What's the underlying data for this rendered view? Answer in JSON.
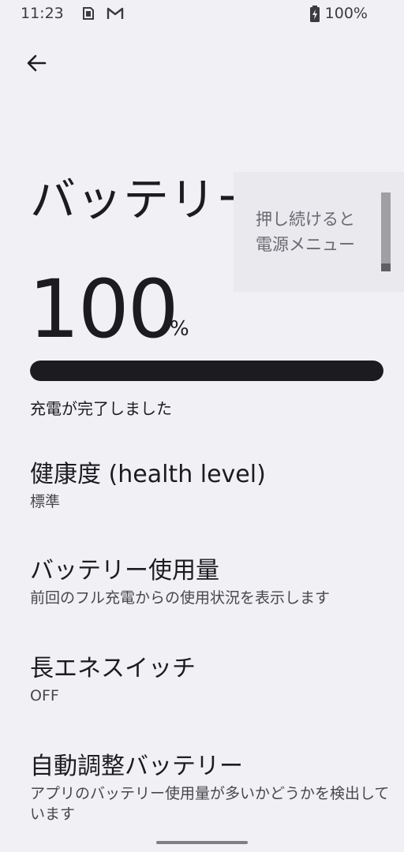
{
  "status_bar": {
    "time": "11:23",
    "battery_text": "100%",
    "icons": [
      "sim-card-icon",
      "gmail-icon",
      "battery-charging-icon"
    ]
  },
  "page": {
    "title": "バッテリー",
    "back_icon": "arrow-back-icon"
  },
  "tooltip": {
    "text": "押し続けると\n電源メニュー"
  },
  "battery": {
    "level": "100",
    "unit": "%",
    "fill_percent": 100,
    "status": "充電が完了しました"
  },
  "settings": [
    {
      "title": "健康度 (health level)",
      "summary": "標準"
    },
    {
      "title": "バッテリー使用量",
      "summary": "前回のフル充電からの使用状況を表示します"
    },
    {
      "title": "長エネスイッチ",
      "summary": "OFF"
    },
    {
      "title": "自動調整バッテリー",
      "summary": "アプリのバッテリー使用量が多いかどうかを検出しています"
    }
  ],
  "colors": {
    "background": "#f1f0f5",
    "text": "#1c1b1f",
    "battery_fill": "#1c1b1f"
  }
}
